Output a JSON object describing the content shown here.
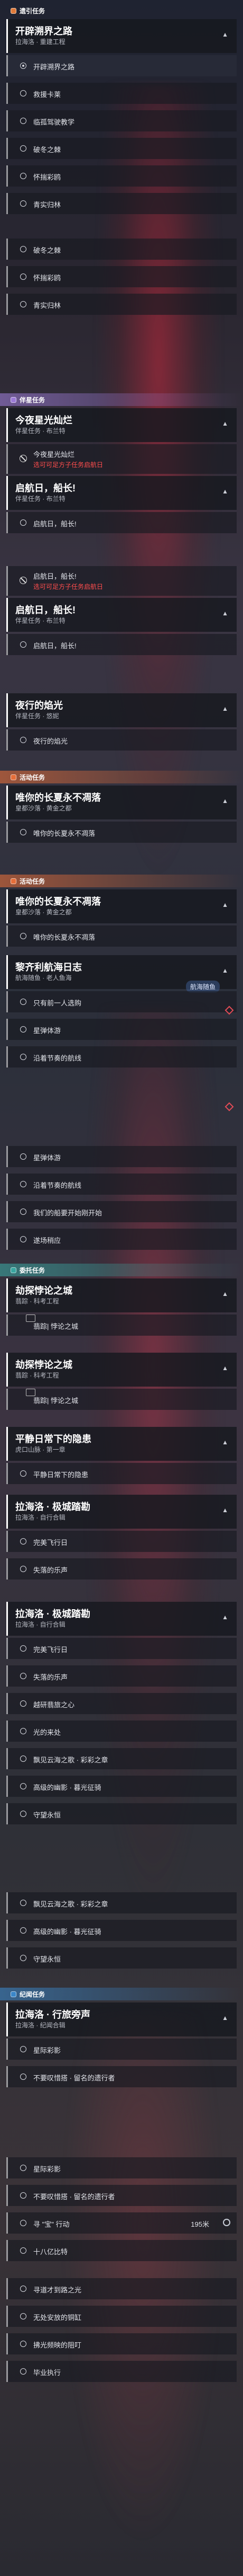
{
  "sections": {
    "s0": {
      "label": "遗引任务",
      "color": "#e07a3a"
    },
    "s1": {
      "label": "伴星任务",
      "color": "#9c7bd6"
    },
    "s2": {
      "label": "活动任务",
      "color": "#e56e3a"
    },
    "s3": {
      "label": "活动任务",
      "color": "#e56e3a"
    },
    "s4": {
      "label": "委托任务",
      "color": "#3aa6a0"
    },
    "s5": {
      "label": "纪闻任务",
      "color": "#3a86c8"
    }
  },
  "cards": {
    "c0": {
      "title": "开辟溯界之路",
      "sub": "拉海洛 · 重建工程"
    },
    "c1": {
      "title": "今夜星光灿烂",
      "sub": "伴星任务 · 布兰特"
    },
    "c2": {
      "title": "启航日，船长!",
      "sub": "伴星任务 · 布兰特"
    },
    "c3": {
      "title": "启航日，船长!",
      "sub": "伴星任务 · 布兰特"
    },
    "c4": {
      "title": "夜行的焰光",
      "sub": "伴星任务 · 悠妮"
    },
    "c5": {
      "title": "唯你的长夏永不凋落",
      "sub": "皇都沙落 · 黄金之都"
    },
    "c6": {
      "title": "唯你的长夏永不凋落",
      "sub": "皇都沙落 · 黄金之都"
    },
    "c7": {
      "title": "黎齐利航海日志",
      "sub": "航海随鱼 · 老人鱼海"
    },
    "c8": {
      "title": "劫探悖论之城",
      "sub": "翡踪 · 科考工程"
    },
    "c9": {
      "title": "劫探悖论之城",
      "sub": "翡踪 · 科考工程"
    },
    "c10": {
      "title": "平静日常下的隐患",
      "sub": "虎口山脉 · 第一章"
    },
    "c11": {
      "title": "拉海洛 · 极城踏勘",
      "sub": "拉海洛 · 自行合辑"
    },
    "c12": {
      "title": "拉海洛 · 极城踏勘",
      "sub": "拉海洛 · 自行合辑"
    },
    "c13": {
      "title": "拉海洛 · 行旅旁声",
      "sub": "拉海洛 · 纪闻合辑"
    }
  },
  "objectives": {
    "o0": "开辟溯界之路",
    "o1": "救援卡莱",
    "o2": "临孤驾驶教学",
    "o3": "破冬之棘",
    "o4": "怀揣彩鸥",
    "o5": "青实归林",
    "o6": "破冬之棘",
    "o7": "怀揣彩鸥",
    "o8": "青实归林",
    "o9": "启航日，船长!",
    "o10": "启航日，船长!",
    "o11": "夜行的焰光",
    "o12": "唯你的长夏永不凋落",
    "o13": "唯你的长夏永不凋落",
    "o14": "只有前一人选购",
    "o15": "星弹体游",
    "o16": "沿着节奏的航线",
    "o17": "星弹体游",
    "o18": "沿着节奏的航线",
    "o19": "我们的船要开始刚开始",
    "o20": "遂场稍应",
    "o21": "翡踪| 悖论之城",
    "o22": "翡踪| 悖论之城",
    "o23": "平静日常下的隐患",
    "o24": "完美飞行日",
    "o25": "失落的乐声",
    "o26": "完美飞行日",
    "o27": "失落的乐声",
    "o28": "越研翡旅之心",
    "o29": "光的来处",
    "o30": "飘见云海之歌 · 彩彩之章",
    "o31": "高级的幽影 · 暮光征骑",
    "o32": "守望永恒",
    "o33": "飘见云海之歌 · 彩彩之章",
    "o34": "高级的幽影 · 暮光征骑",
    "o35": "守望永恒",
    "o36": "星际彩影",
    "o37": "不要叹惜搭 · 留名的遗行者",
    "o38": "星际彩影",
    "o39": "不要叹惜搭 · 留名的遗行者",
    "o40": "寻 \"宝\" 行动",
    "o41": "十八亿比特",
    "o42": "寻道才到路之光",
    "o43": "无处安放的铜缸",
    "o44": "拂光频映的阻叮",
    "o45": "毕业执行"
  },
  "locks": {
    "l0": {
      "title": "今夜星光灿烂",
      "warn": "选可可足方子任务启航日"
    },
    "l1": {
      "title": "启航日，船长!",
      "warn": "选可可足方子任务启航日"
    }
  },
  "distance": "195米",
  "badge_text": "航海随鱼",
  "accent_colors": {
    "primary": "#ffffff",
    "warning": "#ff4d4d",
    "marker": "#e24b56"
  }
}
